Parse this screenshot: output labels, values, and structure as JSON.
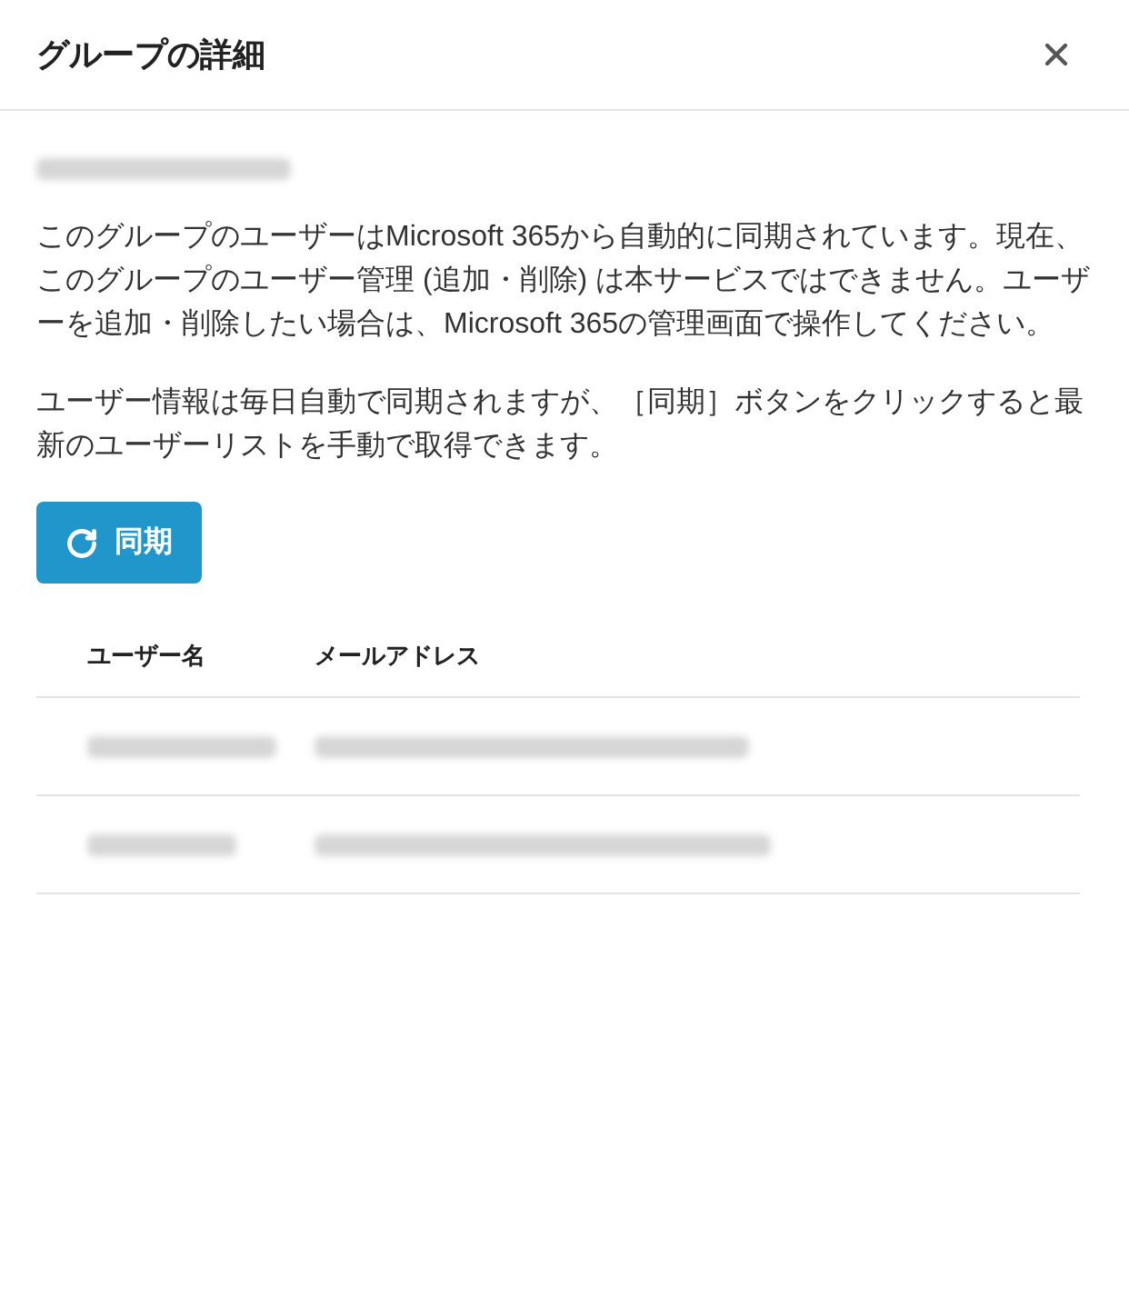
{
  "dialog": {
    "title": "グループの詳細"
  },
  "group_name": {
    "redacted": true
  },
  "paragraphs": [
    "このグループのユーザーはMicrosoft 365から自動的に同期されています。現在、このグループのユーザー管理 (追加・削除) は本サービスではできません。ユーザーを追加・削除したい場合は、Microsoft 365の管理画面で操作してください。",
    "ユーザー情報は毎日自動で同期されますが、［同期］ボタンをクリックすると最新のユーザーリストを手動で取得できます。"
  ],
  "sync_button": {
    "label": "同期"
  },
  "table": {
    "columns": [
      "ユーザー名",
      "メールアドレス"
    ],
    "rows": [
      {
        "cells": [
          {
            "redacted": true
          },
          {
            "redacted": true
          }
        ]
      },
      {
        "cells": [
          {
            "redacted": true
          },
          {
            "redacted": true
          }
        ]
      }
    ]
  }
}
